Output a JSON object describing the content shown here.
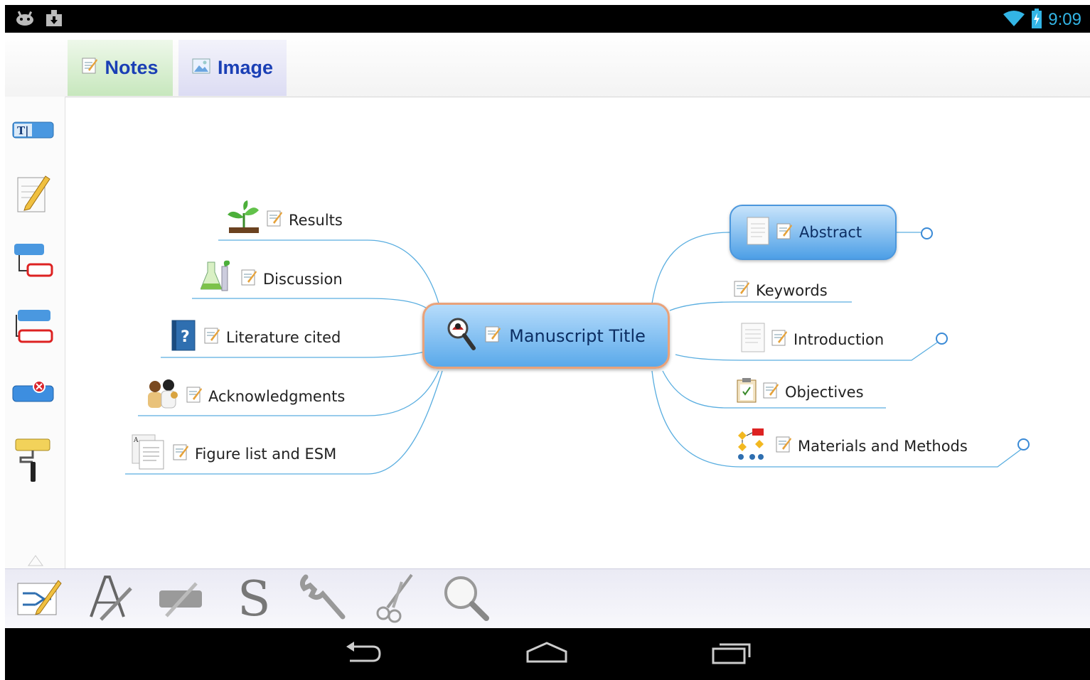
{
  "status_bar": {
    "time": "9:09",
    "clock_color": "#33b5e5",
    "icons": [
      "android-debug-icon",
      "download-notification-icon",
      "wifi-icon",
      "battery-charging-icon"
    ]
  },
  "tabs": [
    {
      "label": "Notes",
      "icon": "note-icon",
      "color": "#c7e7bd"
    },
    {
      "label": "Image",
      "icon": "picture-icon",
      "color": "#dcdcf3"
    }
  ],
  "left_toolbar": {
    "items": [
      "text-field-icon",
      "edit-note-icon",
      "add-child-node-icon",
      "add-sibling-node-icon",
      "delete-node-icon",
      "paint-roller-icon"
    ]
  },
  "mind_map": {
    "central": {
      "label": "Manuscript Title",
      "icon": "magnifier-icon"
    },
    "left_branches": [
      {
        "label": "Results",
        "icon": "seedling-icon"
      },
      {
        "label": "Discussion",
        "icon": "lab-flask-icon"
      },
      {
        "label": "Literature cited",
        "icon": "help-book-icon"
      },
      {
        "label": "Acknowledgments",
        "icon": "people-icon"
      },
      {
        "label": "Figure list and ESM",
        "icon": "documents-icon"
      }
    ],
    "right_branches": [
      {
        "label": "Abstract",
        "icon": "document-icon",
        "selected": true,
        "collapsible": true
      },
      {
        "label": "Keywords",
        "icon": "",
        "collapsible": false
      },
      {
        "label": "Introduction",
        "icon": "document-icon",
        "collapsible": true
      },
      {
        "label": "Objectives",
        "icon": "clipboard-icon",
        "collapsible": false
      },
      {
        "label": "Materials and Methods",
        "icon": "flowchart-icon",
        "collapsible": true
      }
    ],
    "line_color": "#5aaee0",
    "central_border_color": "#e9a27a"
  },
  "bottom_toolbar": {
    "items": [
      "mindmap-edit-icon",
      "font-style-icon",
      "highlighter-icon",
      "currency-s-icon",
      "wrench-icon",
      "scissors-icon",
      "zoom-icon"
    ]
  },
  "nav_bar": {
    "items": [
      "back-icon",
      "home-icon",
      "recent-apps-icon"
    ]
  }
}
